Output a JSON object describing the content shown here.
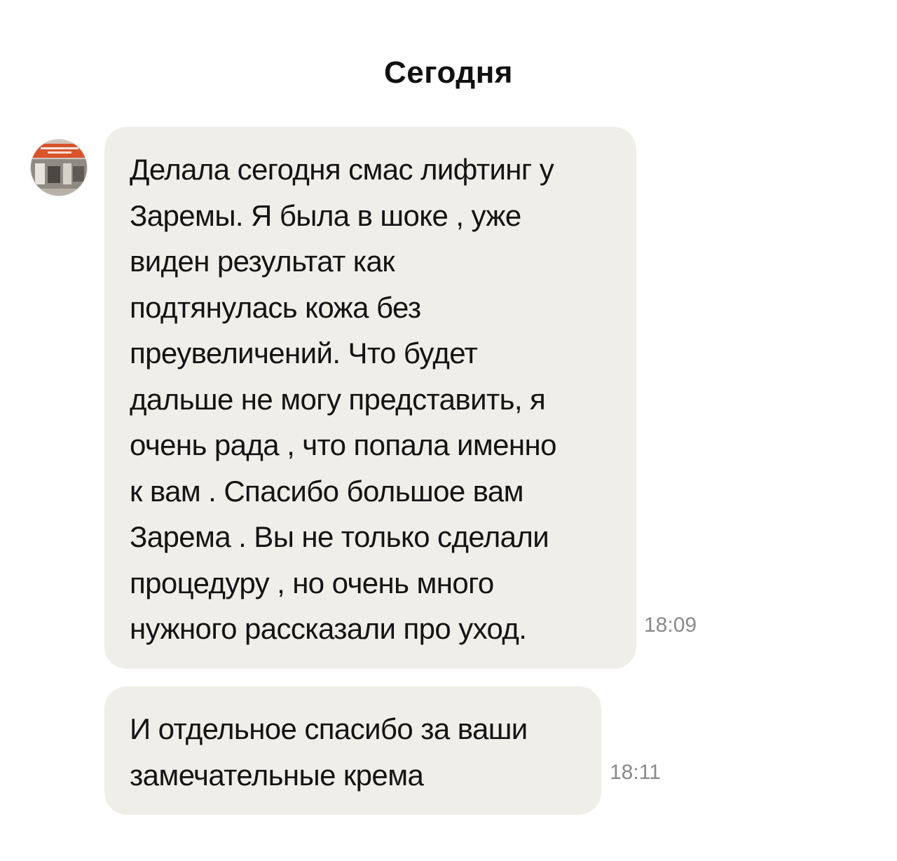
{
  "chat": {
    "date_header": "Сегодня",
    "messages": [
      {
        "text": "Делала сегодня смас лифтинг у\nЗаремы. Я была в шоке , уже\nвиден результат как\nподтянулась кожа без\nпреувеличений. Что будет\nдальше не могу представить, я\nочень рада , что попала именно\nк вам . Спасибо большое вам\nЗарема  . Вы не только сделали\nпроцедуру , но очень много\nнужного рассказали про уход.",
        "time": "18:09"
      },
      {
        "text": "И отдельное спасибо за ваши\nзамечательные крема",
        "time": "18:11"
      }
    ]
  },
  "colors": {
    "bubble_background": "#f0eee8",
    "time_text": "#8a8a8a",
    "avatar_accent": "#d9542b"
  },
  "icons": {
    "avatar": "sender-avatar-image"
  }
}
